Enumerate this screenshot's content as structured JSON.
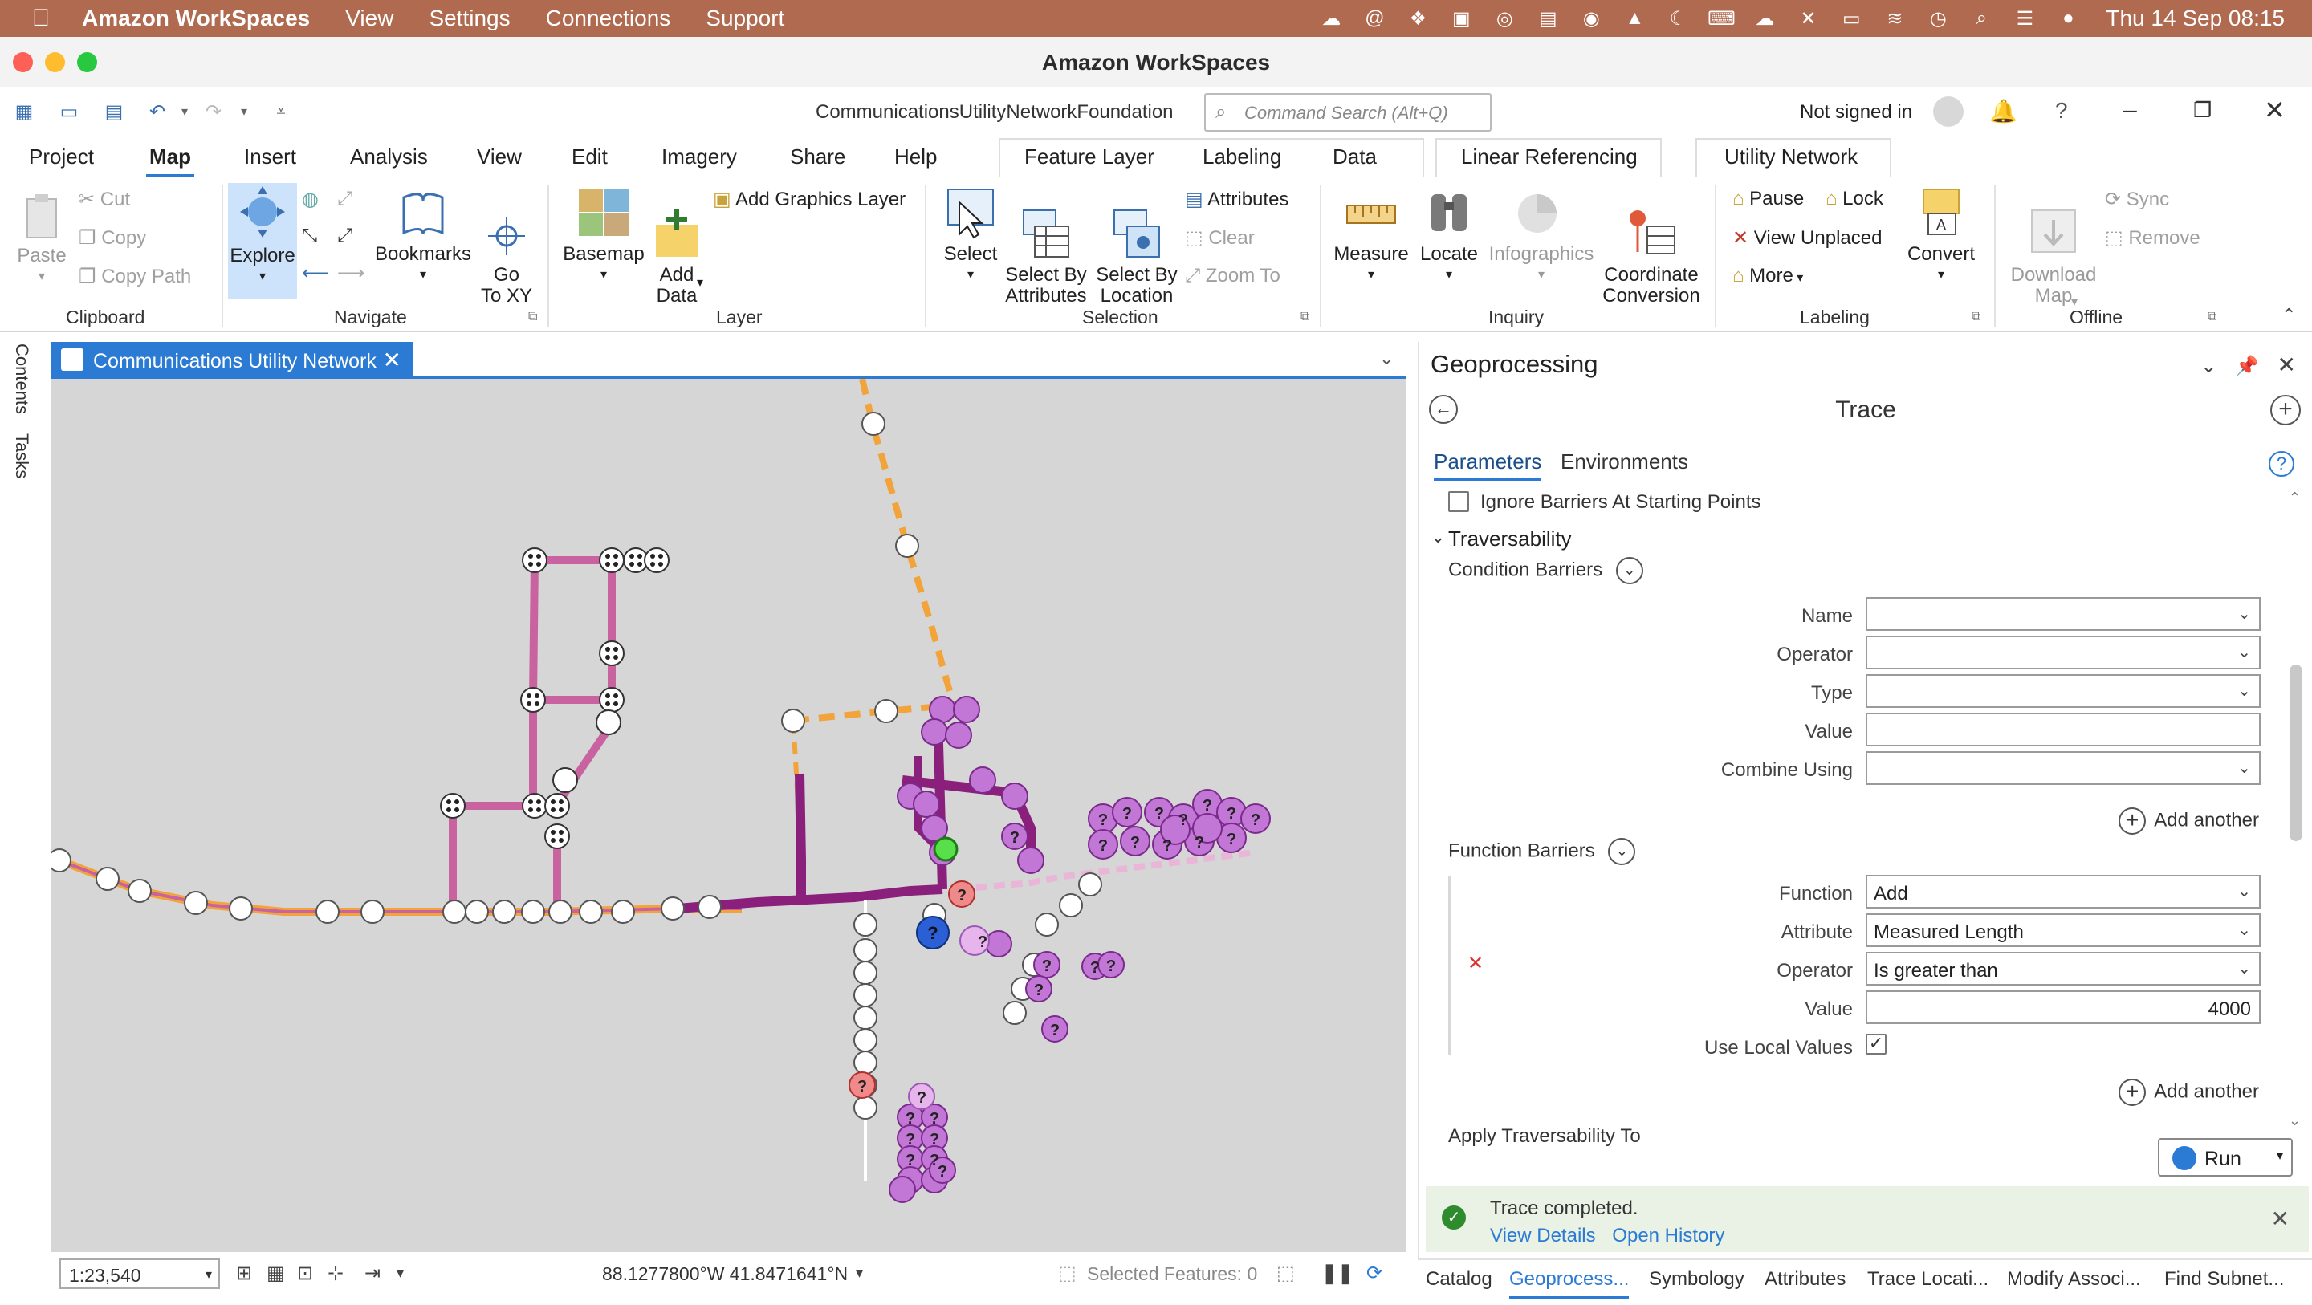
{
  "mac_menu": {
    "app": "Amazon WorkSpaces",
    "items": [
      "View",
      "Settings",
      "Connections",
      "Support"
    ],
    "clock": "Thu 14 Sep  08:15"
  },
  "window": {
    "title": "Amazon WorkSpaces"
  },
  "qat": {
    "project_name": "CommunicationsUtilityNetworkFoundation",
    "search_placeholder": "Command Search (Alt+Q)",
    "signin": "Not signed in"
  },
  "ribbon_tabs": [
    "Project",
    "Map",
    "Insert",
    "Analysis",
    "View",
    "Edit",
    "Imagery",
    "Share",
    "Help"
  ],
  "context_tabs": {
    "feature_layer": [
      "Feature Layer",
      "Labeling",
      "Data"
    ],
    "linear_referencing": "Linear Referencing",
    "utility_network": "Utility Network"
  },
  "ribbon": {
    "clipboard": {
      "paste": "Paste",
      "cut": "Cut",
      "copy": "Copy",
      "copy_path": "Copy Path",
      "group": "Clipboard"
    },
    "navigate": {
      "explore": "Explore",
      "bookmarks": "Bookmarks",
      "goto": "Go\nTo XY",
      "group": "Navigate"
    },
    "layer": {
      "basemap": "Basemap",
      "add_data": "Add\nData",
      "add_graphics": "Add Graphics Layer",
      "group": "Layer"
    },
    "selection": {
      "select": "Select",
      "select_by_attr": "Select By\nAttributes",
      "select_by_loc": "Select By\nLocation",
      "attributes": "Attributes",
      "clear": "Clear",
      "zoom_to": "Zoom To",
      "group": "Selection"
    },
    "inquiry": {
      "measure": "Measure",
      "locate": "Locate",
      "infographics": "Infographics",
      "coord_conv": "Coordinate\nConversion",
      "group": "Inquiry"
    },
    "labeling": {
      "pause": "Pause",
      "lock": "Lock",
      "view_unplaced": "View Unplaced",
      "more": "More",
      "convert": "Convert",
      "group": "Labeling"
    },
    "offline": {
      "download": "Download\nMap",
      "sync": "Sync",
      "remove": "Remove",
      "group": "Offline"
    }
  },
  "side_tabs": [
    "Contents",
    "Tasks"
  ],
  "map": {
    "tab_title": "Communications Utility Network",
    "scale": "1:23,540",
    "coordinates": "88.1277800°W 41.8471641°N",
    "selected": "Selected Features: 0"
  },
  "geoprocessing": {
    "title": "Geoprocessing",
    "tool": "Trace",
    "tabs": [
      "Parameters",
      "Environments"
    ],
    "ignore_barriers": "Ignore Barriers At Starting Points",
    "traversability": "Traversability",
    "condition_barriers": "Condition Barriers",
    "cb_labels": [
      "Name",
      "Operator",
      "Type",
      "Value",
      "Combine Using"
    ],
    "add_another": "Add another",
    "function_barriers": "Function Barriers",
    "fb_labels": [
      "Function",
      "Attribute",
      "Operator",
      "Value"
    ],
    "fb_values": [
      "Add",
      "Measured Length",
      "Is greater than",
      "4000"
    ],
    "use_local_values": "Use Local Values",
    "apply_traversability": "Apply Traversability To",
    "run": "Run",
    "msg_title": "Trace completed.",
    "view_details": "View Details",
    "open_history": "Open History"
  },
  "bottom_tabs": [
    "Catalog",
    "Geoprocess...",
    "Symbology",
    "Attributes",
    "Trace Locati...",
    "Modify Associ...",
    "Find Subnet..."
  ],
  "colors": {
    "accent": "#2b7bd5",
    "menubar": "#b06a4f",
    "map_bg": "#d6d6d6",
    "trace_line": "#8a1f7c",
    "orange_line": "#f2a33a",
    "pink_line": "#c8639f"
  }
}
